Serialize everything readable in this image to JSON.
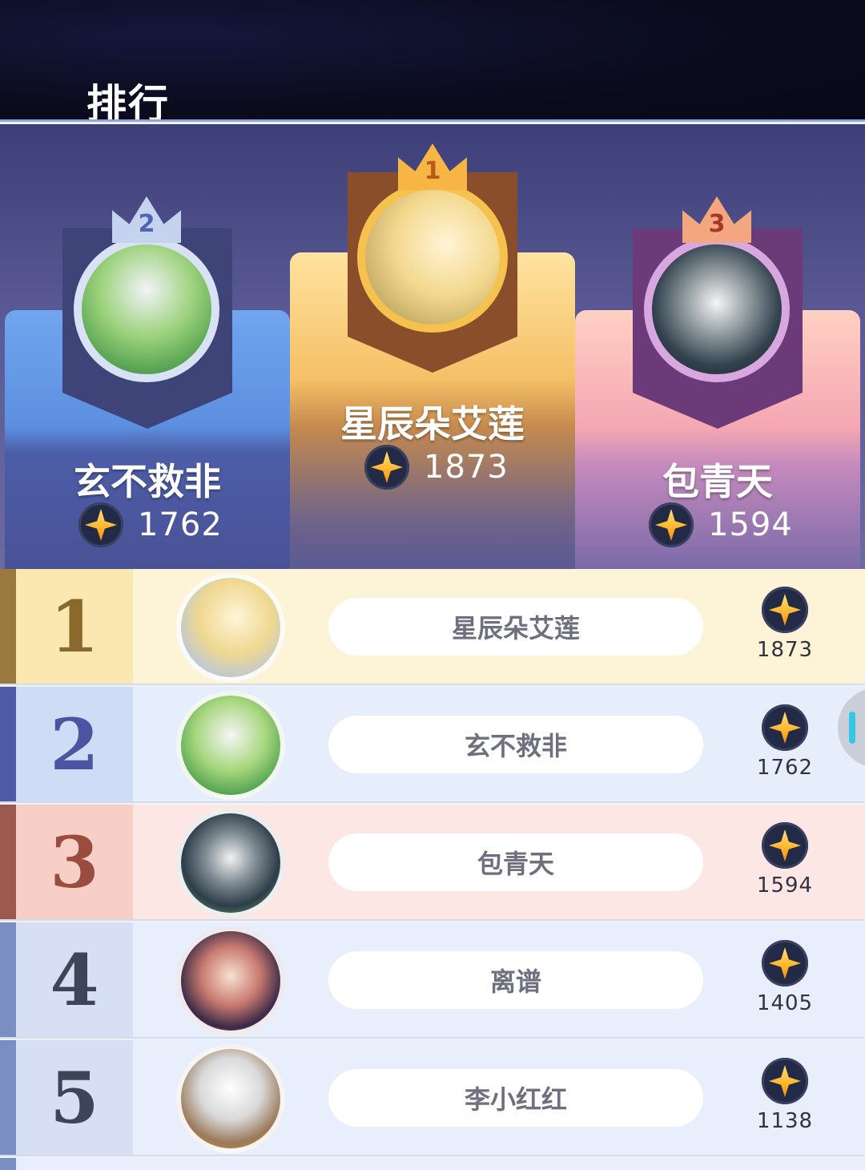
{
  "header": {
    "title": "排行"
  },
  "podium": [
    {
      "rank": "2",
      "name": "玄不救非",
      "score": "1762"
    },
    {
      "rank": "1",
      "name": "星辰朵艾莲",
      "score": "1873"
    },
    {
      "rank": "3",
      "name": "包青天",
      "score": "1594"
    }
  ],
  "rows": [
    {
      "rank": "1",
      "name": "星辰朵艾莲",
      "score": "1873"
    },
    {
      "rank": "2",
      "name": "玄不救非",
      "score": "1762"
    },
    {
      "rank": "3",
      "name": "包青天",
      "score": "1594"
    },
    {
      "rank": "4",
      "name": "离谱",
      "score": "1405"
    },
    {
      "rank": "5",
      "name": "李小红红",
      "score": "1138"
    }
  ],
  "icons": {
    "score": "star-coin-icon",
    "crown": "crown-icon"
  },
  "colors": {
    "gold": "#f6c24d",
    "silver": "#c6d3ef",
    "bronze": "#f4a77e",
    "accent": "#36c6e6"
  }
}
